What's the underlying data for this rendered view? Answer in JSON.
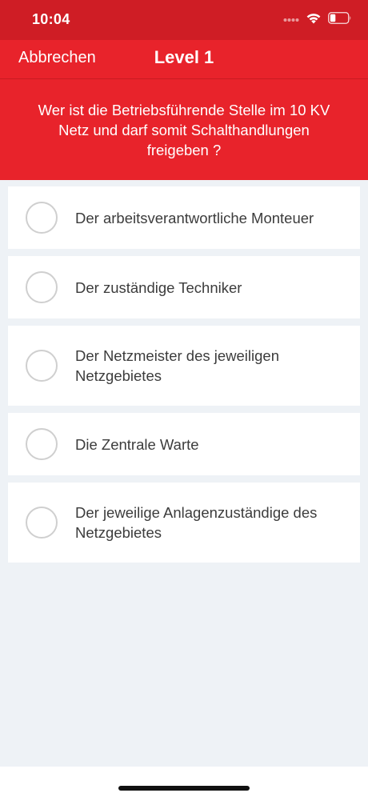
{
  "status": {
    "time": "10:04"
  },
  "nav": {
    "cancel_label": "Abbrechen",
    "title": "Level 1"
  },
  "question": {
    "text": "Wer ist die Betriebsführende Stelle im 10 KV Netz und darf somit Schalthandlungen freigeben ?"
  },
  "answers": [
    {
      "label": "Der arbeitsverantwortliche Monteuer",
      "selected": false
    },
    {
      "label": "Der zuständige Techniker",
      "selected": false
    },
    {
      "label": "Der Netzmeister des jeweiligen Netzgebietes",
      "selected": false
    },
    {
      "label": "Die Zentrale Warte",
      "selected": false
    },
    {
      "label": "Der jeweilige Anlagenzuständige des Netzgebietes",
      "selected": false
    }
  ],
  "colors": {
    "status_bar": "#cf1d25",
    "primary_red": "#e8232b",
    "background": "#eef2f6",
    "card": "#ffffff",
    "radio_border": "#cfcfcf",
    "text": "#3c3c3c"
  },
  "icons": [
    "signal-dots-icon",
    "wifi-icon",
    "battery-low-icon"
  ]
}
